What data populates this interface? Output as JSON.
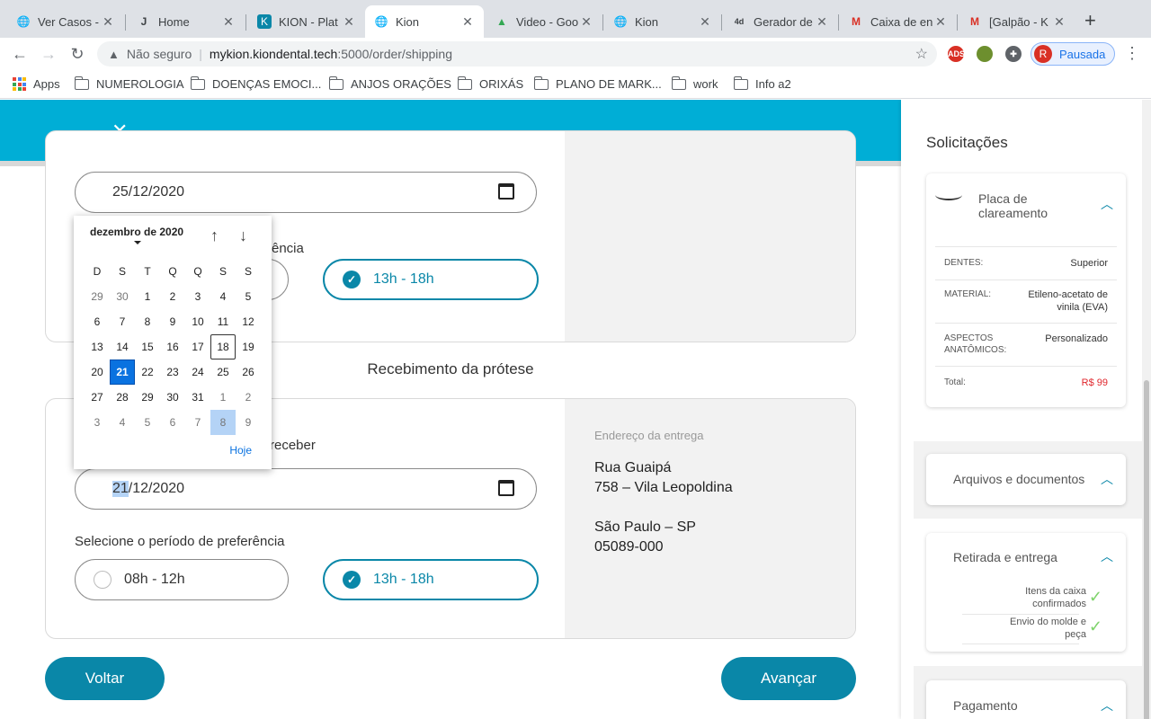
{
  "browser": {
    "tabs": [
      {
        "title": "Ver Casos -",
        "icon": "globe-icon"
      },
      {
        "title": "Home",
        "icon": "j-logo-icon"
      },
      {
        "title": "KION - Plat",
        "icon": "kion-icon"
      },
      {
        "title": "Kion",
        "icon": "globe-icon"
      },
      {
        "title": "Video - Goo",
        "icon": "drive-icon"
      },
      {
        "title": "Kion",
        "icon": "globe-icon"
      },
      {
        "title": "Gerador de",
        "icon": "4d-icon"
      },
      {
        "title": "Caixa de en",
        "icon": "gmail-icon"
      },
      {
        "title": "[Galpão - K",
        "icon": "gmail-icon"
      }
    ],
    "address": {
      "security": "Não seguro",
      "host": "mykion.kiondental.tech",
      "path": ":5000/order/shipping"
    },
    "profile": {
      "initial": "R",
      "label": "Pausada"
    },
    "bookmarks": [
      "Apps",
      "NUMEROLOGIA",
      "DOENÇAS EMOCI...",
      "ANJOS ORAÇÕES",
      "ORIXÁS",
      "PLANO DE MARK...",
      "work",
      "Info a2"
    ]
  },
  "pickup": {
    "date_value": "25/12/2020",
    "period_label_partial": "ência",
    "period_selected": "13h - 18h"
  },
  "delivery": {
    "section_title": "Recebimento da prótese",
    "date_label_partial": "receber",
    "date_value_day": "21",
    "date_value_rest": "/12/2020",
    "period_label": "Selecione o período de preferência",
    "period_option_1": "08h - 12h",
    "period_option_2": "13h - 18h",
    "address_label": "Endereço da entrega",
    "address_line1": "Rua Guaipá",
    "address_line2": "758 – Vila Leopoldina",
    "address_line3": "São Paulo – SP",
    "address_line4": "05089-000"
  },
  "calendar": {
    "month": "dezembro de 2020",
    "weekdays": [
      "D",
      "S",
      "T",
      "Q",
      "Q",
      "S",
      "S"
    ],
    "days": [
      {
        "d": "29",
        "s": "muted"
      },
      {
        "d": "30",
        "s": "muted"
      },
      {
        "d": "1",
        "s": ""
      },
      {
        "d": "2",
        "s": ""
      },
      {
        "d": "3",
        "s": ""
      },
      {
        "d": "4",
        "s": ""
      },
      {
        "d": "5",
        "s": ""
      },
      {
        "d": "6",
        "s": ""
      },
      {
        "d": "7",
        "s": ""
      },
      {
        "d": "8",
        "s": ""
      },
      {
        "d": "9",
        "s": ""
      },
      {
        "d": "10",
        "s": ""
      },
      {
        "d": "11",
        "s": ""
      },
      {
        "d": "12",
        "s": ""
      },
      {
        "d": "13",
        "s": ""
      },
      {
        "d": "14",
        "s": ""
      },
      {
        "d": "15",
        "s": ""
      },
      {
        "d": "16",
        "s": ""
      },
      {
        "d": "17",
        "s": ""
      },
      {
        "d": "18",
        "s": "today"
      },
      {
        "d": "19",
        "s": ""
      },
      {
        "d": "20",
        "s": ""
      },
      {
        "d": "21",
        "s": "sel"
      },
      {
        "d": "22",
        "s": ""
      },
      {
        "d": "23",
        "s": ""
      },
      {
        "d": "24",
        "s": ""
      },
      {
        "d": "25",
        "s": ""
      },
      {
        "d": "26",
        "s": ""
      },
      {
        "d": "27",
        "s": ""
      },
      {
        "d": "28",
        "s": ""
      },
      {
        "d": "29",
        "s": ""
      },
      {
        "d": "30",
        "s": ""
      },
      {
        "d": "31",
        "s": ""
      },
      {
        "d": "1",
        "s": "muted"
      },
      {
        "d": "2",
        "s": "muted"
      },
      {
        "d": "3",
        "s": "muted"
      },
      {
        "d": "4",
        "s": "muted"
      },
      {
        "d": "5",
        "s": "muted"
      },
      {
        "d": "6",
        "s": "muted"
      },
      {
        "d": "7",
        "s": "muted"
      },
      {
        "d": "8",
        "s": "hl"
      },
      {
        "d": "9",
        "s": "muted"
      }
    ],
    "today_label": "Hoje"
  },
  "buttons": {
    "back": "Voltar",
    "next": "Avançar"
  },
  "sidebar": {
    "title": "Solicitações",
    "product": {
      "name": "Placa de clareamento",
      "rows": [
        {
          "k": "DENTES:",
          "v": "Superior"
        },
        {
          "k": "MATERIAL:",
          "v": "Etileno-acetato de vinila (EVA)"
        },
        {
          "k": "ASPECTOS ANATÔMICOS:",
          "v": "Personalizado"
        },
        {
          "k": "Total:",
          "v": "R$ 99"
        }
      ]
    },
    "files": "Arquivos e documentos",
    "shipping": {
      "title": "Retirada e entrega",
      "items": [
        "Itens da caixa confirmados",
        "Envio do molde e peça"
      ]
    },
    "payment": "Pagamento"
  },
  "colors": {
    "brand": "#00aed6",
    "primary": "#0a87a8",
    "total": "#e0262c"
  }
}
